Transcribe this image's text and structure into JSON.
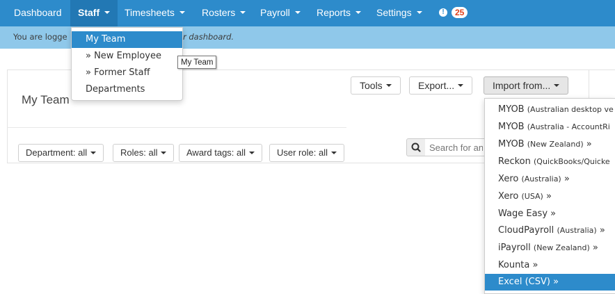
{
  "nav": {
    "dashboard": "Dashboard",
    "staff": "Staff",
    "timesheets": "Timesheets",
    "rosters": "Rosters",
    "payroll": "Payroll",
    "reports": "Reports",
    "settings": "Settings",
    "alerts_icon": "!",
    "alerts_count": "25"
  },
  "info": {
    "text_left": "You are logge",
    "text_right": "r dashboard."
  },
  "staff_menu": {
    "items": [
      "My Team",
      "» New Employee",
      "» Former Staff",
      "Departments"
    ],
    "selected": "My Team"
  },
  "tooltip": "My Team",
  "page": {
    "title": "My Team"
  },
  "toolbar": {
    "tools": "Tools",
    "export": "Export...",
    "import": "Import from..."
  },
  "filters": {
    "department": "Department: all",
    "roles": "Roles: all",
    "award_tags": "Award tags: all",
    "user_role": "User role: all"
  },
  "search": {
    "placeholder": "Search for an"
  },
  "import_menu": {
    "items": [
      {
        "label": "MYOB",
        "sub": "(Australian desktop ve",
        "suffix": ""
      },
      {
        "label": "MYOB",
        "sub": "(Australia - AccountRi",
        "suffix": ""
      },
      {
        "label": "MYOB",
        "sub": "(New Zealand)",
        "suffix": "»"
      },
      {
        "label": "Reckon",
        "sub": "(QuickBooks/Quicke",
        "suffix": ""
      },
      {
        "label": "Xero",
        "sub": "(Australia)",
        "suffix": "»"
      },
      {
        "label": "Xero",
        "sub": "(USA)",
        "suffix": "»"
      },
      {
        "label": "Wage Easy",
        "sub": "",
        "suffix": "»"
      },
      {
        "label": "CloudPayroll",
        "sub": "(Australia)",
        "suffix": "»"
      },
      {
        "label": "iPayroll",
        "sub": "(New Zealand)",
        "suffix": "»"
      },
      {
        "label": "Kounta",
        "sub": "",
        "suffix": "»"
      },
      {
        "label": "Excel (CSV)",
        "sub": "",
        "suffix": "»"
      }
    ],
    "highlighted": "Excel (CSV)"
  },
  "colors": {
    "navbar": "#2d8bcb",
    "navbar_active": "#2278b4",
    "infobar": "#8fc8ea",
    "badge_text": "#e0421d"
  },
  "icons": {
    "search": "search-icon",
    "alert": "alert-icon"
  }
}
